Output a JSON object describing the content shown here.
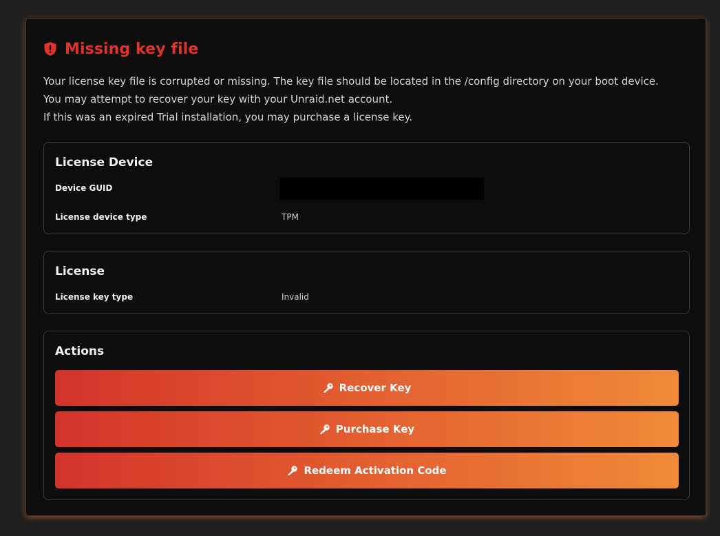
{
  "header": {
    "title": "Missing key file",
    "icon": "shield-alert-icon",
    "title_color": "#e0332a"
  },
  "description": [
    "Your license key file is corrupted or missing. The key file should be located in the /config directory on your boot device.",
    "You may attempt to recover your key with your Unraid.net account.",
    "If this was an expired Trial installation, you may purchase a license key."
  ],
  "license_device": {
    "title": "License Device",
    "rows": [
      {
        "label": "Device GUID",
        "value": ""
      },
      {
        "label": "License device type",
        "value": "TPM"
      }
    ]
  },
  "license": {
    "title": "License",
    "rows": [
      {
        "label": "License key type",
        "value": "Invalid"
      }
    ]
  },
  "actions": {
    "title": "Actions",
    "buttons": [
      {
        "label": "Recover Key",
        "icon": "key-icon"
      },
      {
        "label": "Purchase Key",
        "icon": "key-icon"
      },
      {
        "label": "Redeem Activation Code",
        "icon": "key-icon"
      }
    ],
    "gradient": [
      "#d3332b",
      "#f08a38"
    ]
  }
}
